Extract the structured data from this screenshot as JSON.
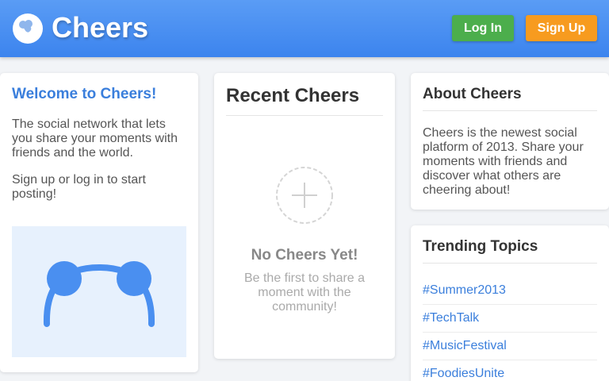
{
  "header": {
    "brand": "Cheers",
    "login_label": "Log In",
    "signup_label": "Sign Up"
  },
  "welcome": {
    "title": "Welcome to Cheers!",
    "text1": "The social network that lets you share your moments with friends and the world.",
    "text2": "Sign up or log in to start posting!"
  },
  "recent": {
    "title": "Recent Cheers",
    "empty_title": "No Cheers Yet!",
    "empty_text": "Be the first to share a moment with the community!"
  },
  "about": {
    "title": "About Cheers",
    "text": "Cheers is the newest social platform of 2013. Share your moments with friends and discover what others are cheering about!"
  },
  "trending": {
    "title": "Trending Topics",
    "items": [
      "#Summer2013",
      "#TechTalk",
      "#MusicFestival",
      "#FoodiesUnite"
    ]
  },
  "colors": {
    "header": "#3c84ee",
    "login": "#4cae4c",
    "signup": "#f79b1f",
    "accent": "#3b7fdc"
  }
}
